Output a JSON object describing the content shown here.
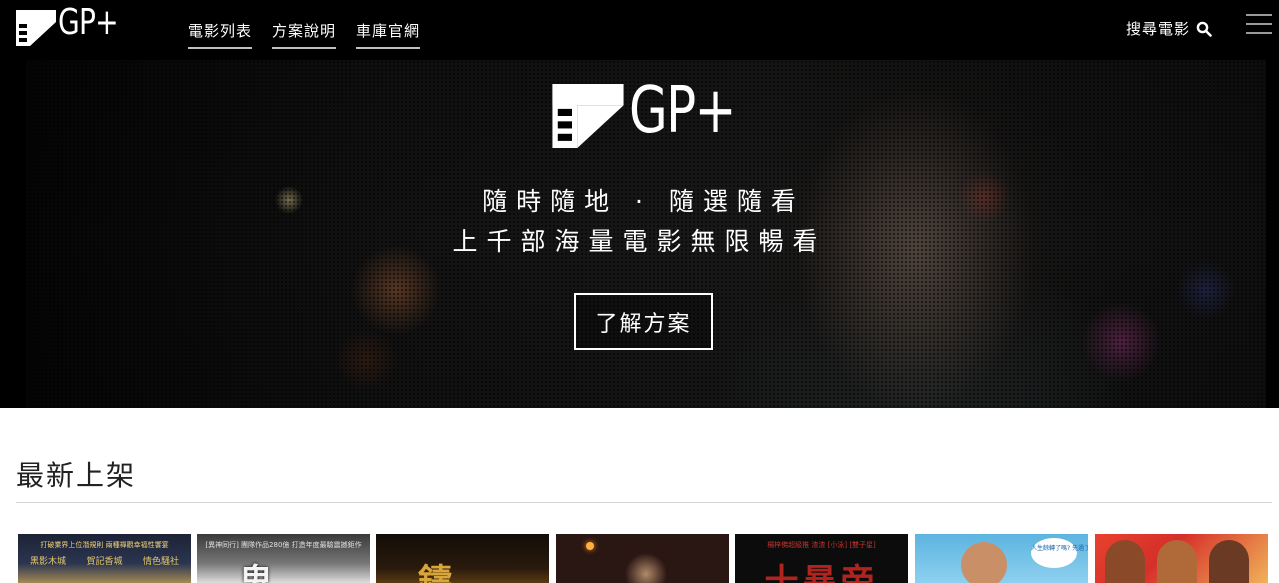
{
  "header": {
    "logo_text": "GP+",
    "nav": [
      {
        "label": "電影列表"
      },
      {
        "label": "方案說明"
      },
      {
        "label": "車庫官網"
      }
    ],
    "search_label": "搜尋電影",
    "icons": [
      "film-logo-icon",
      "search-icon",
      "hamburger-menu-icon"
    ]
  },
  "hero": {
    "logo_text": "GP+",
    "line1": "隨時隨地 · 隨選隨看",
    "line2": "上千部海量電影無限暢看",
    "cta_label": "了解方案"
  },
  "latest": {
    "title": "最新上架",
    "posters": [
      {
        "caption": "打破業界上位潛規則  兩種禪觀幸福性饗宴",
        "row": [
          "黑影木城",
          "賀記香城",
          "情色騷社"
        ]
      },
      {
        "caption": "[異神同行] 團隊作品280億 打造年度最驗震撼鉅作",
        "big": "鬼..."
      },
      {
        "caption": "",
        "big": "鑄..."
      },
      {
        "caption": ""
      },
      {
        "caption": "楊梓佛超級推 渣渣 [小泳] [雙子星]",
        "big": "十暴帝"
      },
      {
        "caption": "人生餘轉了嗎? 先過了去就好了!"
      },
      {
        "caption": ""
      }
    ]
  },
  "colors": {
    "header_bg": "#000000",
    "text_on_dark": "#ffffff",
    "nav_underline": "#bfbfbf",
    "section_rule": "#d4d4d4"
  }
}
